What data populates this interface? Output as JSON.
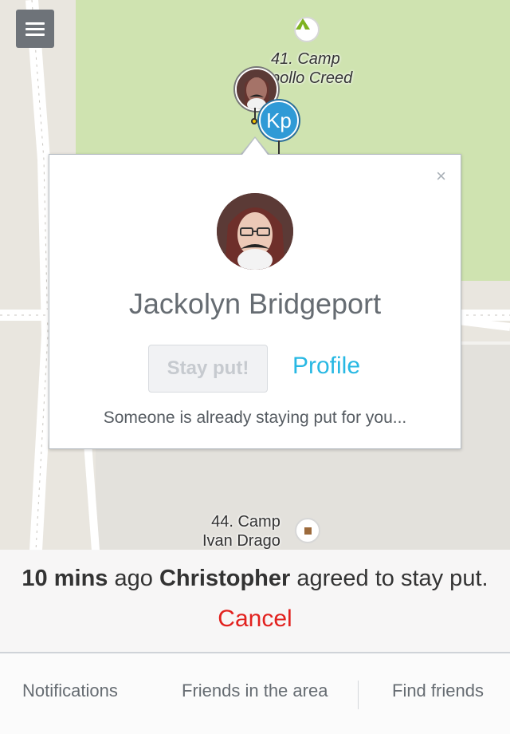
{
  "map": {
    "menu_button_icon": "layers-list-icon",
    "pois": [
      {
        "label_line1": "41. Camp",
        "label_line2": "pollo Creed",
        "icon": "campsite-tent-icon"
      },
      {
        "label_line1": "44. Camp",
        "label_line2": "Ivan Drago",
        "icon": "square-marker-icon"
      }
    ],
    "pins": {
      "kp_initials": "Kp"
    }
  },
  "popup": {
    "name": "Jackolyn Bridgeport",
    "stay_put_label": "Stay put!",
    "profile_label": "Profile",
    "note": "Someone is already staying put for you...",
    "close_symbol": "×"
  },
  "status": {
    "time": "10 mins",
    "ago": "ago",
    "person": "Christopher",
    "action": "agreed to stay put.",
    "cancel_label": "Cancel"
  },
  "tabs": [
    {
      "label": "Notifications"
    },
    {
      "label": "Friends in the area"
    },
    {
      "label": "Find friends"
    }
  ],
  "colors": {
    "link_blue": "#28b8e3",
    "cancel_red": "#e2221f",
    "park_green": "#cfe3b0",
    "kp_pin_blue": "#2f9ad6"
  }
}
